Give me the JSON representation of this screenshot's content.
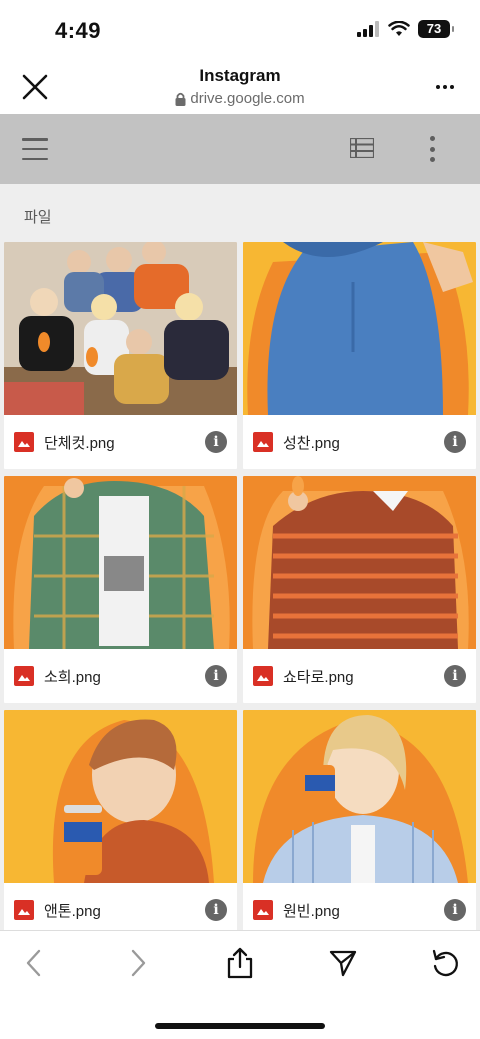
{
  "status": {
    "time": "4:49",
    "battery": "73"
  },
  "header": {
    "title": "Instagram",
    "url": "drive.google.com"
  },
  "section": {
    "label": "파일"
  },
  "files": [
    {
      "name": "단체컷.png"
    },
    {
      "name": "성찬.png"
    },
    {
      "name": "소희.png"
    },
    {
      "name": "쇼타로.png"
    },
    {
      "name": "앤톤.png"
    },
    {
      "name": "원빈.png"
    }
  ],
  "colors": {
    "accent_red": "#d93025",
    "toolbar_gray": "#c2c2c2",
    "orange": "#f0832a",
    "yellow": "#f7b733"
  },
  "icons": {
    "close": "close-icon",
    "lock": "lock-icon",
    "more": "more-horizontal-icon",
    "menu": "hamburger-menu-icon",
    "list_view": "list-view-icon",
    "overflow": "more-vertical-icon",
    "file_type": "image-file-icon",
    "info": "info-icon",
    "back": "chevron-left-icon",
    "forward": "chevron-right-icon",
    "share": "share-icon",
    "send": "send-icon",
    "reload": "reload-icon"
  }
}
